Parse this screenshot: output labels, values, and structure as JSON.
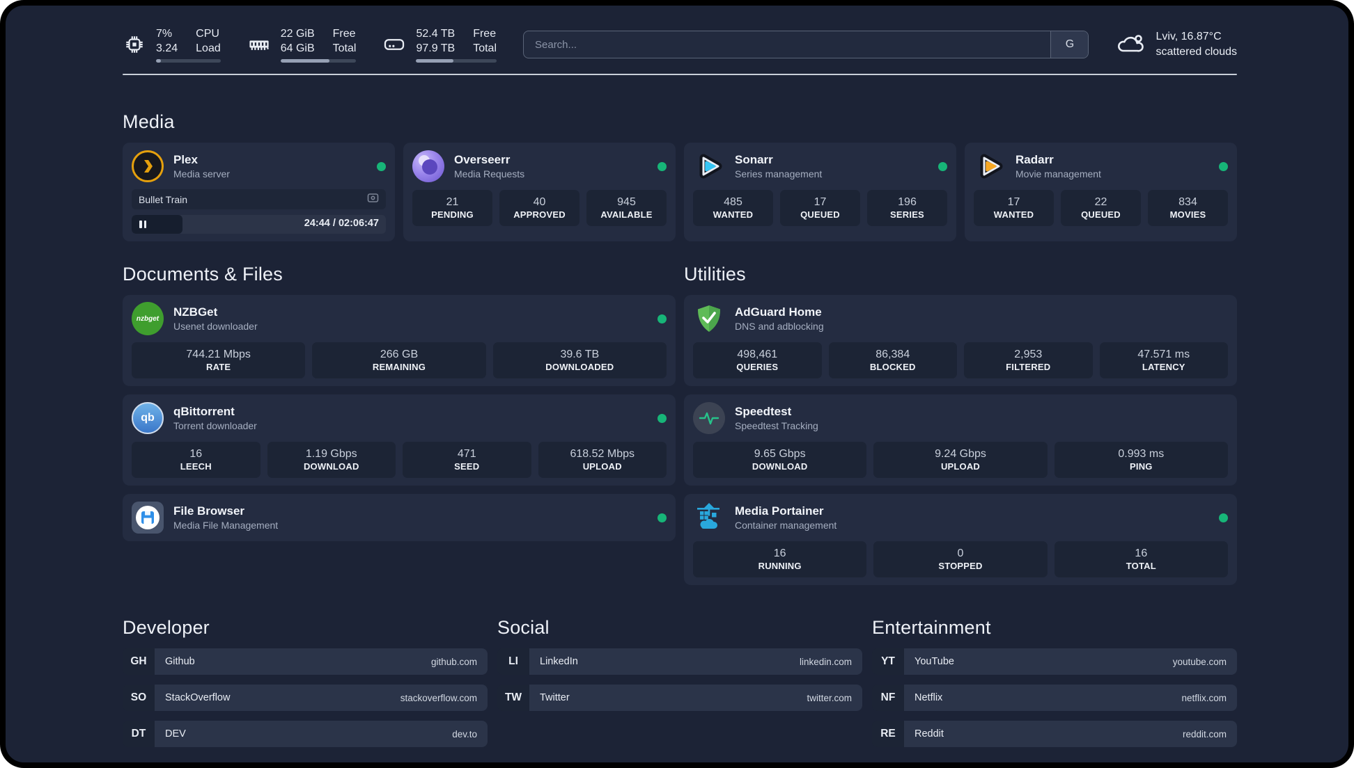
{
  "topbar": {
    "metrics": [
      {
        "name": "cpu",
        "value_top": "7%",
        "value_bottom": "3.24",
        "label_top": "CPU",
        "label_bottom": "Load",
        "progress_pct": 8
      },
      {
        "name": "memory",
        "value_top": "22 GiB",
        "value_bottom": "64 GiB",
        "label_top": "Free",
        "label_bottom": "Total",
        "progress_pct": 65
      },
      {
        "name": "storage",
        "value_top": "52.4 TB",
        "value_bottom": "97.9 TB",
        "label_top": "Free",
        "label_bottom": "Total",
        "progress_pct": 46
      }
    ],
    "search": {
      "placeholder": "Search...",
      "button_label": "G"
    },
    "weather": {
      "location": "Lviv, 16.87°C",
      "condition": "scattered clouds"
    }
  },
  "media": {
    "title": "Media",
    "plex": {
      "name": "Plex",
      "subtitle": "Media server",
      "online": true,
      "now_playing": "Bullet Train",
      "time_display": "24:44 / 02:06:47",
      "progress_pct": 20
    },
    "overseerr": {
      "name": "Overseerr",
      "subtitle": "Media Requests",
      "online": true,
      "stats": [
        {
          "value": "21",
          "label": "PENDING"
        },
        {
          "value": "40",
          "label": "APPROVED"
        },
        {
          "value": "945",
          "label": "AVAILABLE"
        }
      ]
    },
    "sonarr": {
      "name": "Sonarr",
      "subtitle": "Series management",
      "online": true,
      "stats": [
        {
          "value": "485",
          "label": "WANTED"
        },
        {
          "value": "17",
          "label": "QUEUED"
        },
        {
          "value": "196",
          "label": "SERIES"
        }
      ]
    },
    "radarr": {
      "name": "Radarr",
      "subtitle": "Movie management",
      "online": true,
      "stats": [
        {
          "value": "17",
          "label": "WANTED"
        },
        {
          "value": "22",
          "label": "QUEUED"
        },
        {
          "value": "834",
          "label": "MOVIES"
        }
      ]
    }
  },
  "documents": {
    "title": "Documents & Files",
    "nzbget": {
      "name": "NZBGet",
      "subtitle": "Usenet downloader",
      "online": true,
      "badge_text": "nzbget",
      "stats": [
        {
          "value": "744.21 Mbps",
          "label": "RATE"
        },
        {
          "value": "266 GB",
          "label": "REMAINING"
        },
        {
          "value": "39.6 TB",
          "label": "DOWNLOADED"
        }
      ]
    },
    "qbittorrent": {
      "name": "qBittorrent",
      "subtitle": "Torrent downloader",
      "online": true,
      "badge_text": "qb",
      "stats": [
        {
          "value": "16",
          "label": "LEECH"
        },
        {
          "value": "1.19 Gbps",
          "label": "DOWNLOAD"
        },
        {
          "value": "471",
          "label": "SEED"
        },
        {
          "value": "618.52 Mbps",
          "label": "UPLOAD"
        }
      ]
    },
    "filebrowser": {
      "name": "File Browser",
      "subtitle": "Media File Management",
      "online": true
    }
  },
  "utilities": {
    "title": "Utilities",
    "adguard": {
      "name": "AdGuard Home",
      "subtitle": "DNS and adblocking",
      "stats": [
        {
          "value": "498,461",
          "label": "QUERIES"
        },
        {
          "value": "86,384",
          "label": "BLOCKED"
        },
        {
          "value": "2,953",
          "label": "FILTERED"
        },
        {
          "value": "47.571 ms",
          "label": "LATENCY"
        }
      ]
    },
    "speedtest": {
      "name": "Speedtest",
      "subtitle": "Speedtest Tracking",
      "stats": [
        {
          "value": "9.65 Gbps",
          "label": "DOWNLOAD"
        },
        {
          "value": "9.24 Gbps",
          "label": "UPLOAD"
        },
        {
          "value": "0.993 ms",
          "label": "PING"
        }
      ]
    },
    "portainer": {
      "name": "Media Portainer",
      "subtitle": "Container management",
      "online": true,
      "stats": [
        {
          "value": "16",
          "label": "RUNNING"
        },
        {
          "value": "0",
          "label": "STOPPED"
        },
        {
          "value": "16",
          "label": "TOTAL"
        }
      ]
    }
  },
  "links": {
    "developer": {
      "title": "Developer",
      "items": [
        {
          "tag": "GH",
          "name": "Github",
          "url": "github.com"
        },
        {
          "tag": "SO",
          "name": "StackOverflow",
          "url": "stackoverflow.com"
        },
        {
          "tag": "DT",
          "name": "DEV",
          "url": "dev.to"
        }
      ]
    },
    "social": {
      "title": "Social",
      "items": [
        {
          "tag": "LI",
          "name": "LinkedIn",
          "url": "linkedin.com"
        },
        {
          "tag": "TW",
          "name": "Twitter",
          "url": "twitter.com"
        }
      ]
    },
    "entertainment": {
      "title": "Entertainment",
      "items": [
        {
          "tag": "YT",
          "name": "YouTube",
          "url": "youtube.com"
        },
        {
          "tag": "NF",
          "name": "Netflix",
          "url": "netflix.com"
        },
        {
          "tag": "RE",
          "name": "Reddit",
          "url": "reddit.com"
        }
      ]
    }
  },
  "colors": {
    "status_online": "#17b578",
    "plex_yellow": "#e5a00d",
    "sonarr_cyan": "#35c5f4",
    "radarr_orange": "#f7a824",
    "nzbget_green": "#3f9e2e",
    "qbittorrent_blue": "#3a77c9",
    "adguard_green": "#5fbb57",
    "portainer_blue": "#29a8dd",
    "speedtest_pulse": "#27c28a"
  }
}
